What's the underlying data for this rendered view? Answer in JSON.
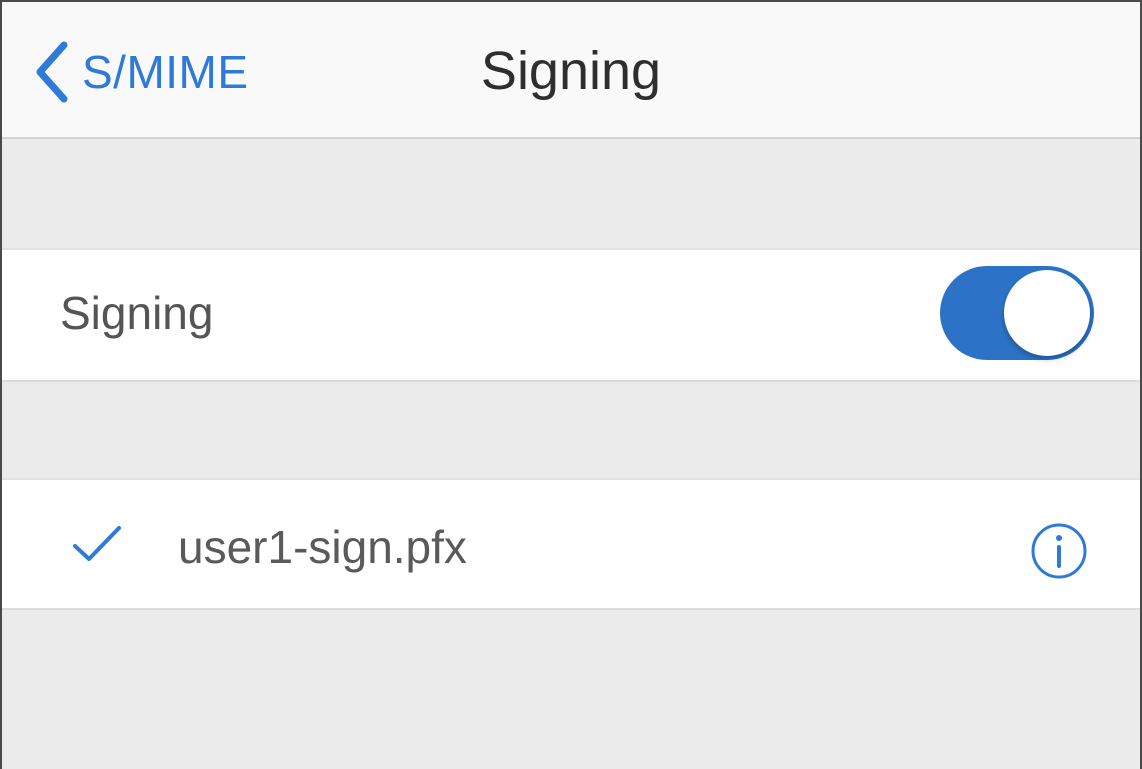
{
  "navbar": {
    "back_label": "S/MIME",
    "title": "Signing"
  },
  "signing_toggle": {
    "label": "Signing",
    "on": true,
    "accent_color": "#2c73c8"
  },
  "certificates": [
    {
      "name": "user1-sign.pfx",
      "selected": true,
      "check_icon": "checkmark-icon",
      "info_icon": "info-icon"
    }
  ],
  "colors": {
    "link": "#2f7ad8",
    "background": "#ebebeb",
    "cell": "#ffffff"
  }
}
